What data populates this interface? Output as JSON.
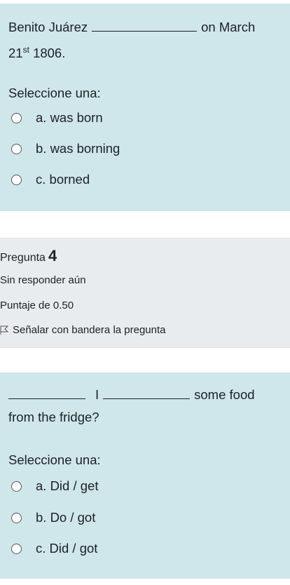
{
  "question3": {
    "line1_start": "Benito Juárez",
    "line1_end": "on March",
    "line2_num": "21",
    "line2_sup": "st",
    "line2_end": "1806.",
    "prompt": "Seleccione una:",
    "options": [
      "a. was born",
      "b. was borning",
      "c. borned"
    ]
  },
  "info": {
    "question_label": "Pregunta",
    "question_number": "4",
    "status": "Sin responder aún",
    "score": "Puntaje de 0.50",
    "flag_label": "Señalar con bandera la pregunta"
  },
  "question4": {
    "line1_mid": "I",
    "line1_end": "some food",
    "line2": "from the fridge?",
    "prompt": "Seleccione una:",
    "options": [
      "a. Did / get",
      "b. Do / got",
      "c. Did / got"
    ]
  }
}
